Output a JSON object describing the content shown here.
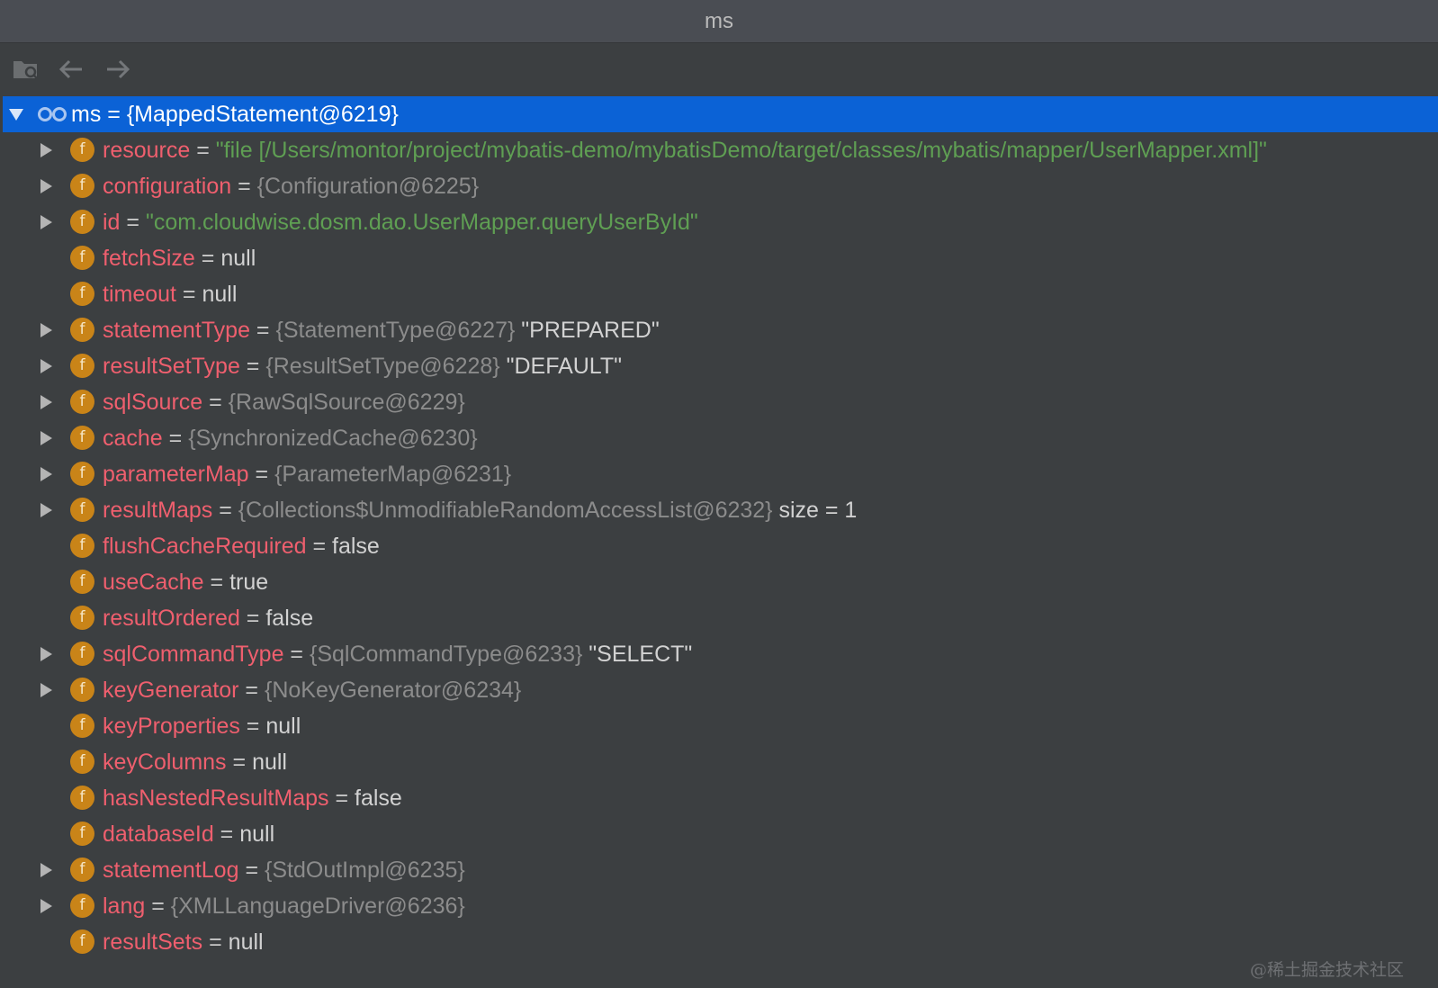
{
  "window": {
    "title": "ms"
  },
  "toolbar": {
    "icons": [
      "folder-watch-icon",
      "arrow-left-icon",
      "arrow-right-icon"
    ]
  },
  "root": {
    "name": "ms",
    "eq": " = ",
    "value": "{MappedStatement@6219}",
    "expanded": true
  },
  "fields": [
    {
      "expandable": true,
      "name": "resource",
      "eq": " = ",
      "value": "\"file [/Users/montor/project/mybatis-demo/mybatisDemo/target/classes/mybatis/mapper/UserMapper.xml]\"",
      "kind": "str",
      "suffix": ""
    },
    {
      "expandable": true,
      "name": "configuration",
      "eq": " = ",
      "value": "{Configuration@6225}",
      "kind": "obj",
      "suffix": ""
    },
    {
      "expandable": true,
      "name": "id",
      "eq": " = ",
      "value": "\"com.cloudwise.dosm.dao.UserMapper.queryUserById\"",
      "kind": "str",
      "suffix": ""
    },
    {
      "expandable": false,
      "name": "fetchSize",
      "eq": " = ",
      "value": "null",
      "kind": "plain",
      "suffix": ""
    },
    {
      "expandable": false,
      "name": "timeout",
      "eq": " = ",
      "value": "null",
      "kind": "plain",
      "suffix": ""
    },
    {
      "expandable": true,
      "name": "statementType",
      "eq": " = ",
      "value": "{StatementType@6227}",
      "kind": "obj",
      "suffix": " \"PREPARED\""
    },
    {
      "expandable": true,
      "name": "resultSetType",
      "eq": " = ",
      "value": "{ResultSetType@6228}",
      "kind": "obj",
      "suffix": " \"DEFAULT\""
    },
    {
      "expandable": true,
      "name": "sqlSource",
      "eq": " = ",
      "value": "{RawSqlSource@6229}",
      "kind": "obj",
      "suffix": ""
    },
    {
      "expandable": true,
      "name": "cache",
      "eq": " = ",
      "value": "{SynchronizedCache@6230}",
      "kind": "obj",
      "suffix": ""
    },
    {
      "expandable": true,
      "name": "parameterMap",
      "eq": " = ",
      "value": "{ParameterMap@6231}",
      "kind": "obj",
      "suffix": ""
    },
    {
      "expandable": true,
      "name": "resultMaps",
      "eq": " = ",
      "value": "{Collections$UnmodifiableRandomAccessList@6232}",
      "kind": "obj",
      "suffix": "  size = 1"
    },
    {
      "expandable": false,
      "name": "flushCacheRequired",
      "eq": " = ",
      "value": "false",
      "kind": "plain",
      "suffix": ""
    },
    {
      "expandable": false,
      "name": "useCache",
      "eq": " = ",
      "value": "true",
      "kind": "plain",
      "suffix": ""
    },
    {
      "expandable": false,
      "name": "resultOrdered",
      "eq": " = ",
      "value": "false",
      "kind": "plain",
      "suffix": ""
    },
    {
      "expandable": true,
      "name": "sqlCommandType",
      "eq": " = ",
      "value": "{SqlCommandType@6233}",
      "kind": "obj",
      "suffix": " \"SELECT\""
    },
    {
      "expandable": true,
      "name": "keyGenerator",
      "eq": " = ",
      "value": "{NoKeyGenerator@6234}",
      "kind": "obj",
      "suffix": ""
    },
    {
      "expandable": false,
      "name": "keyProperties",
      "eq": " = ",
      "value": "null",
      "kind": "plain",
      "suffix": ""
    },
    {
      "expandable": false,
      "name": "keyColumns",
      "eq": " = ",
      "value": "null",
      "kind": "plain",
      "suffix": ""
    },
    {
      "expandable": false,
      "name": "hasNestedResultMaps",
      "eq": " = ",
      "value": "false",
      "kind": "plain",
      "suffix": ""
    },
    {
      "expandable": false,
      "name": "databaseId",
      "eq": " = ",
      "value": "null",
      "kind": "plain",
      "suffix": ""
    },
    {
      "expandable": true,
      "name": "statementLog",
      "eq": " = ",
      "value": "{StdOutImpl@6235}",
      "kind": "obj",
      "suffix": ""
    },
    {
      "expandable": true,
      "name": "lang",
      "eq": " = ",
      "value": "{XMLLanguageDriver@6236}",
      "kind": "obj",
      "suffix": ""
    },
    {
      "expandable": false,
      "name": "resultSets",
      "eq": " = ",
      "value": "null",
      "kind": "plain",
      "suffix": ""
    }
  ],
  "field_icon_letter": "f",
  "watermark": "@稀土掘金技术社区",
  "colors": {
    "background": "#3c3f41",
    "titlebar": "#4a4d53",
    "selection": "#0b62d6",
    "field_name": "#ef5f6e",
    "string_value": "#5f9f53",
    "object_value": "#8c8c8c",
    "field_icon": "#c98418"
  }
}
